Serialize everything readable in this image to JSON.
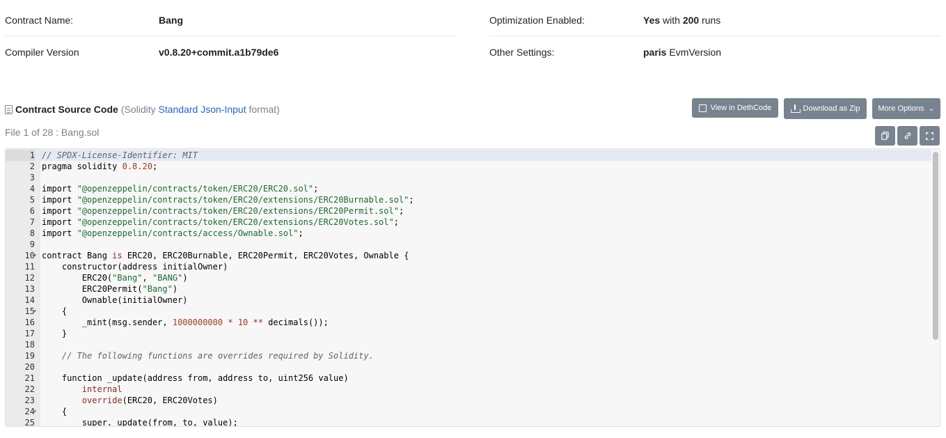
{
  "info": {
    "contract_name_label": "Contract Name:",
    "contract_name_value": "Bang",
    "compiler_label": "Compiler Version",
    "compiler_value": "v0.8.20+commit.a1b79de6",
    "optimization_label": "Optimization Enabled:",
    "optimization_yes": "Yes",
    "optimization_with": " with ",
    "optimization_runs": "200",
    "optimization_runs_suffix": " runs",
    "other_label": "Other Settings:",
    "other_evm": "paris",
    "other_evm_suffix": " EvmVersion"
  },
  "source": {
    "title": "Contract Source Code",
    "paren_open": "(Solidity ",
    "link_text": "Standard Json-Input",
    "paren_close": " format)",
    "file_label": "File 1 of 28 : Bang.sol"
  },
  "buttons": {
    "deth": "View in DethCode",
    "zip": "Download as Zip",
    "more": "More Options"
  },
  "icons": {
    "copy": "copy-icon",
    "link": "link-icon",
    "fullscreen": "fullscreen-icon"
  },
  "code_lines": [
    {
      "n": "1",
      "fold": false,
      "active": true,
      "parts": [
        {
          "t": "// SPDX-License-Identifier: MIT",
          "c": "cmt"
        }
      ]
    },
    {
      "n": "2",
      "fold": false,
      "parts": [
        {
          "t": "pragma solidity ",
          "c": ""
        },
        {
          "t": "0.8.20",
          "c": "num"
        },
        {
          "t": ";",
          "c": ""
        }
      ]
    },
    {
      "n": "3",
      "fold": false,
      "parts": []
    },
    {
      "n": "4",
      "fold": false,
      "parts": [
        {
          "t": "import ",
          "c": ""
        },
        {
          "t": "\"@openzeppelin/contracts/token/ERC20/ERC20.sol\"",
          "c": "str"
        },
        {
          "t": ";",
          "c": ""
        }
      ]
    },
    {
      "n": "5",
      "fold": false,
      "parts": [
        {
          "t": "import ",
          "c": ""
        },
        {
          "t": "\"@openzeppelin/contracts/token/ERC20/extensions/ERC20Burnable.sol\"",
          "c": "str"
        },
        {
          "t": ";",
          "c": ""
        }
      ]
    },
    {
      "n": "6",
      "fold": false,
      "parts": [
        {
          "t": "import ",
          "c": ""
        },
        {
          "t": "\"@openzeppelin/contracts/token/ERC20/extensions/ERC20Permit.sol\"",
          "c": "str"
        },
        {
          "t": ";",
          "c": ""
        }
      ]
    },
    {
      "n": "7",
      "fold": false,
      "parts": [
        {
          "t": "import ",
          "c": ""
        },
        {
          "t": "\"@openzeppelin/contracts/token/ERC20/extensions/ERC20Votes.sol\"",
          "c": "str"
        },
        {
          "t": ";",
          "c": ""
        }
      ]
    },
    {
      "n": "8",
      "fold": false,
      "parts": [
        {
          "t": "import ",
          "c": ""
        },
        {
          "t": "\"@openzeppelin/contracts/access/Ownable.sol\"",
          "c": "str"
        },
        {
          "t": ";",
          "c": ""
        }
      ]
    },
    {
      "n": "9",
      "fold": false,
      "parts": []
    },
    {
      "n": "10",
      "fold": true,
      "parts": [
        {
          "t": "contract Bang ",
          "c": ""
        },
        {
          "t": "is",
          "c": "kw"
        },
        {
          "t": " ERC20, ERC20Burnable, ERC20Permit, ERC20Votes, Ownable {",
          "c": ""
        }
      ]
    },
    {
      "n": "11",
      "fold": false,
      "parts": [
        {
          "t": "    constructor(address initialOwner)",
          "c": ""
        }
      ]
    },
    {
      "n": "12",
      "fold": false,
      "parts": [
        {
          "t": "        ERC20(",
          "c": ""
        },
        {
          "t": "\"Bang\"",
          "c": "str"
        },
        {
          "t": ", ",
          "c": ""
        },
        {
          "t": "\"BANG\"",
          "c": "str"
        },
        {
          "t": ")",
          "c": ""
        }
      ]
    },
    {
      "n": "13",
      "fold": false,
      "parts": [
        {
          "t": "        ERC20Permit(",
          "c": ""
        },
        {
          "t": "\"Bang\"",
          "c": "str"
        },
        {
          "t": ")",
          "c": ""
        }
      ]
    },
    {
      "n": "14",
      "fold": false,
      "parts": [
        {
          "t": "        Ownable(initialOwner)",
          "c": ""
        }
      ]
    },
    {
      "n": "15",
      "fold": true,
      "parts": [
        {
          "t": "    {",
          "c": ""
        }
      ]
    },
    {
      "n": "16",
      "fold": false,
      "parts": [
        {
          "t": "        _mint(msg.sender, ",
          "c": ""
        },
        {
          "t": "1000000000",
          "c": "num"
        },
        {
          "t": " ",
          "c": ""
        },
        {
          "t": "*",
          "c": "kw"
        },
        {
          "t": " ",
          "c": ""
        },
        {
          "t": "10",
          "c": "num"
        },
        {
          "t": " ",
          "c": ""
        },
        {
          "t": "**",
          "c": "kw"
        },
        {
          "t": " decimals());",
          "c": ""
        }
      ]
    },
    {
      "n": "17",
      "fold": false,
      "parts": [
        {
          "t": "    }",
          "c": ""
        }
      ]
    },
    {
      "n": "18",
      "fold": false,
      "parts": []
    },
    {
      "n": "19",
      "fold": false,
      "parts": [
        {
          "t": "    ",
          "c": ""
        },
        {
          "t": "// The following functions are overrides required by Solidity.",
          "c": "cmt"
        }
      ]
    },
    {
      "n": "20",
      "fold": false,
      "parts": []
    },
    {
      "n": "21",
      "fold": false,
      "parts": [
        {
          "t": "    function _update(address from, address to, uint256 value)",
          "c": ""
        }
      ]
    },
    {
      "n": "22",
      "fold": false,
      "parts": [
        {
          "t": "        ",
          "c": ""
        },
        {
          "t": "internal",
          "c": "kw"
        }
      ]
    },
    {
      "n": "23",
      "fold": false,
      "parts": [
        {
          "t": "        ",
          "c": ""
        },
        {
          "t": "override",
          "c": "kw"
        },
        {
          "t": "(ERC20, ERC20Votes)",
          "c": ""
        }
      ]
    },
    {
      "n": "24",
      "fold": true,
      "parts": [
        {
          "t": "    {",
          "c": ""
        }
      ]
    },
    {
      "n": "25",
      "fold": false,
      "parts": [
        {
          "t": "        super._update(from, to, value);",
          "c": ""
        }
      ]
    }
  ]
}
